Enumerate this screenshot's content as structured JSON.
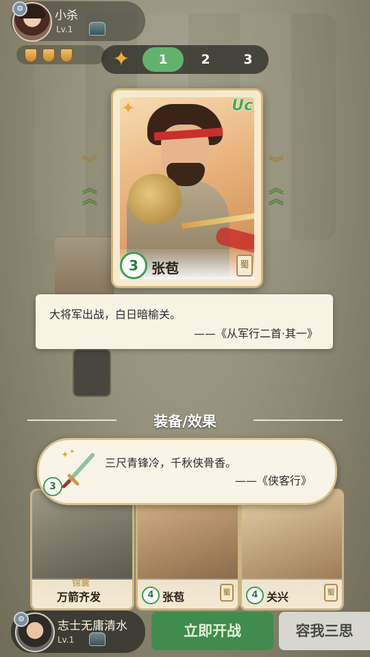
{
  "top_player": {
    "name": "小杀",
    "level": "Lv.1",
    "avatar_icon": "female-hero-avatar",
    "shields": 3
  },
  "tabs": {
    "star_icon": "sparkle-icon",
    "items": [
      "1",
      "2",
      "3"
    ],
    "active_index": 0
  },
  "hero_card": {
    "rarity": "Uc",
    "cost": "3",
    "name": "张苞",
    "faction": "蜀"
  },
  "hero_quote": {
    "line1": "大将军出战，白日暗榆关。",
    "line2": "——《从军行二首·其一》"
  },
  "equipment": {
    "title": "装备/效果",
    "cost": "3",
    "line1": "三尺青锋冷，千秋侠骨香。",
    "line2": "——《侠客行》"
  },
  "hand": [
    {
      "type": "锦囊",
      "name": "万箭齐发",
      "cost": ""
    },
    {
      "type": "",
      "name": "张苞",
      "cost": "4",
      "faction": "蜀"
    },
    {
      "type": "",
      "name": "关兴",
      "cost": "4",
      "faction": "蜀"
    }
  ],
  "bottom_player": {
    "name": "志士无庸清水",
    "level": "Lv.1"
  },
  "buttons": {
    "fight": "立即开战",
    "think": "容我三思"
  },
  "colors": {
    "accent_green": "#3f8c4e",
    "tab_active": "#62b26e",
    "card_border": "#d4b57a"
  }
}
